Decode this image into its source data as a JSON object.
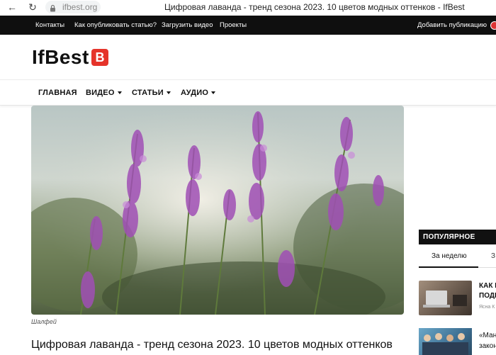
{
  "browser": {
    "url": "ifbest.org",
    "title": "Цифровая лаванда - тренд сезона 2023. 10 цветов модных оттенков - IfBest"
  },
  "topbar": {
    "links": [
      "Контакты",
      "Как опубликовать статью?",
      "Загрузить видео",
      "Проекты"
    ],
    "add_publication": "Добавить публикацию"
  },
  "logo": {
    "text": "IfBest",
    "badge": "B"
  },
  "mainnav": {
    "items": [
      {
        "label": "ГЛАВНАЯ"
      },
      {
        "label": "ВИДЕО"
      },
      {
        "label": "СТАТЬИ"
      },
      {
        "label": "АУДИО"
      }
    ]
  },
  "article": {
    "image_caption": "Шалфей",
    "title": "Цифровая лаванда - тренд сезона 2023. 10 цветов модных оттенков"
  },
  "sidebar": {
    "popular_heading": "ПОПУЛЯРНОЕ",
    "tab_week": "За неделю",
    "tab_next": "З",
    "items": [
      {
        "title_line1": "КАК И",
        "title_line2": "ПОДР",
        "author": "Ясна К"
      },
      {
        "title_line1": "«Ман",
        "title_line2": "закон"
      }
    ]
  },
  "colors": {
    "topbar_bg": "#0f0f0f",
    "logo_badge": "#e5332a",
    "popular_heading_bg": "#111111"
  }
}
